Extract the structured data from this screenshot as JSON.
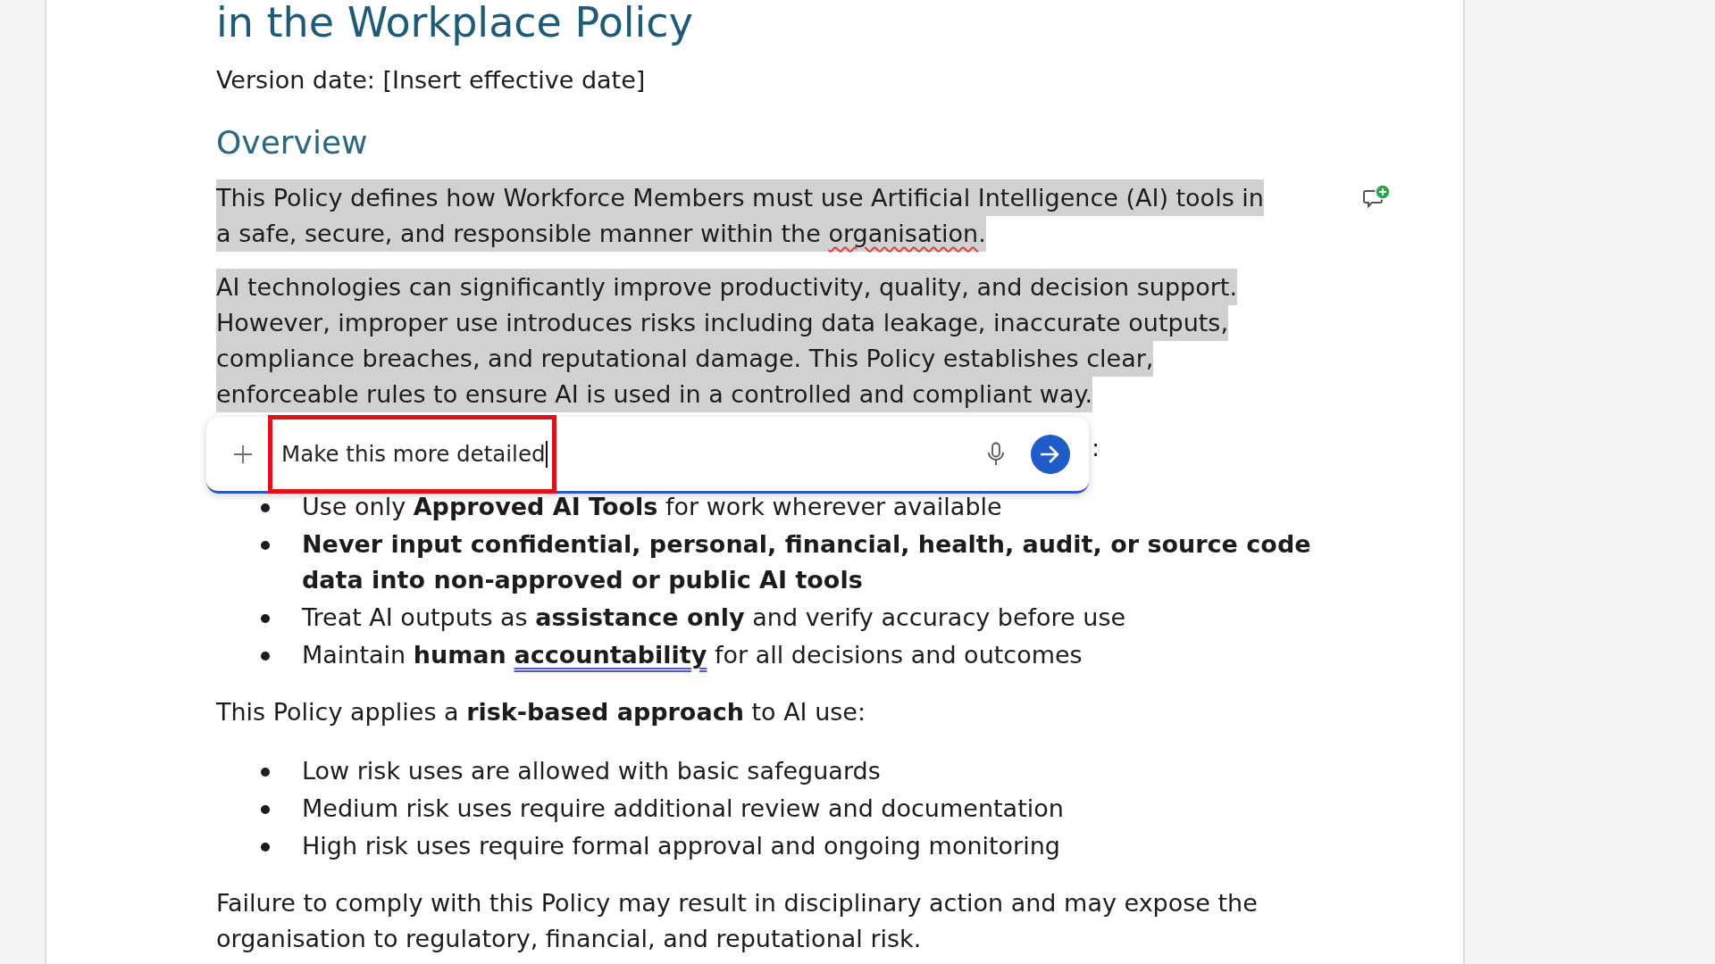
{
  "document": {
    "title": "in the Workplace Policy",
    "version_date": "Version date: [Insert effective date]",
    "blocks": [
      {
        "kind": "heading",
        "text": "Overview"
      },
      {
        "kind": "paragraph",
        "selected": true,
        "comment_icon": true,
        "parts": [
          {
            "kind": "plain",
            "text": "This Policy defines how Workforce Members must use Artificial Intelligence (AI) tools in a safe, secure, and responsible manner within the "
          },
          {
            "kind": "misspelled",
            "text": "organisation"
          },
          {
            "kind": "plain",
            "text": ". "
          }
        ]
      },
      {
        "kind": "paragraph",
        "selected": true,
        "comment_icon": false,
        "parts": [
          {
            "kind": "plain",
            "text": "AI technologies can significantly improve productivity, quality, and decision support. However, improper use introduces risks including data leakage, inaccurate outputs, compliance breaches, and reputational damage. This Policy establishes clear, enforceable rules to ensure AI is used in a controlled and compliant way."
          }
        ]
      },
      {
        "kind": "covered_paragraph",
        "visible_text": ":"
      },
      {
        "kind": "bullets",
        "items": [
          {
            "bold": false,
            "parts": [
              {
                "kind": "plain",
                "text": "Use only **Approved AI Tools** for work wherever available"
              }
            ]
          },
          {
            "bold": true,
            "parts": [
              {
                "kind": "plain",
                "text": "Never input confidential, personal, financial, health, audit, or source code data into non-approved or public AI tools"
              }
            ]
          },
          {
            "bold": false,
            "parts": [
              {
                "kind": "plain",
                "text": "Treat AI outputs as **assistance only** and verify accuracy before use"
              }
            ]
          },
          {
            "bold": false,
            "parts": [
              {
                "kind": "plain",
                "text": "Maintain **human** "
              },
              {
                "kind": "flagged",
                "text": "**accountability**"
              },
              {
                "kind": "plain",
                "text": " for all decisions and outcomes"
              }
            ]
          }
        ]
      },
      {
        "kind": "paragraph",
        "selected": false,
        "comment_icon": false,
        "parts": [
          {
            "kind": "plain",
            "text": "This Policy applies a **risk-based approach** to AI use:"
          }
        ]
      },
      {
        "kind": "bullets",
        "items": [
          {
            "bold": false,
            "parts": [
              {
                "kind": "plain",
                "text": "Low risk uses are allowed with basic safeguards"
              }
            ]
          },
          {
            "bold": false,
            "parts": [
              {
                "kind": "plain",
                "text": "Medium risk uses require additional review and documentation"
              }
            ]
          },
          {
            "bold": false,
            "parts": [
              {
                "kind": "plain",
                "text": "High risk uses require formal approval and ongoing monitoring"
              }
            ]
          }
        ]
      },
      {
        "kind": "paragraph",
        "selected": false,
        "comment_icon": false,
        "parts": [
          {
            "kind": "plain",
            "text": "Failure to comply with this Policy may result in disciplinary action and may expose the organisation to regulatory, financial, and reputational risk."
          }
        ]
      }
    ]
  },
  "prompt_bar": {
    "value": "Make this more detailed"
  }
}
